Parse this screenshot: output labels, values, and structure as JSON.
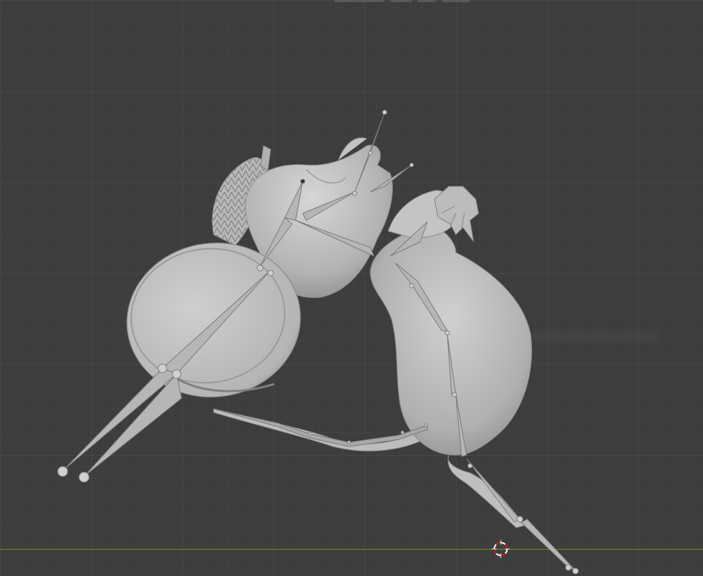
{
  "app": {
    "viewport_mode": "3D Viewport"
  },
  "colors": {
    "background": "#3d3d3d",
    "grid_major": "#474747",
    "grid_minor": "#414141",
    "x_axis": "#6b8f2a",
    "mesh_light": "#c9c9c9",
    "mesh_mid": "#a9a9a9",
    "mesh_shadow": "#8a8a8a",
    "bone": "#b4b4b4",
    "cursor_red": "#d01c1c",
    "cursor_white": "#ffffff"
  },
  "icons": {
    "cursor": "3d-cursor-icon"
  }
}
